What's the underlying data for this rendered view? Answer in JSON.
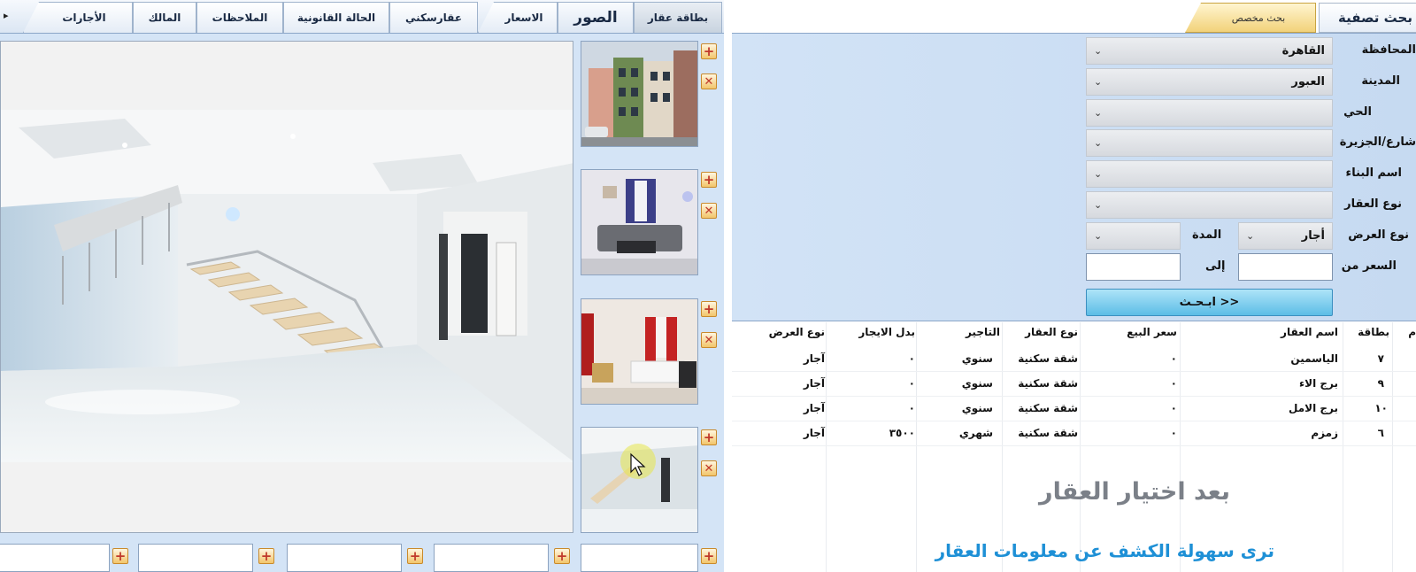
{
  "left_tabs": [
    {
      "id": "rentals",
      "label": "الأجارات"
    },
    {
      "id": "owner",
      "label": "المالك"
    },
    {
      "id": "notes",
      "label": "الملاحظات"
    },
    {
      "id": "legal",
      "label": "الحالة القانونية"
    },
    {
      "id": "aqarskni",
      "label": "عقارسكني"
    },
    {
      "id": "prices",
      "label": "الاسعار"
    },
    {
      "id": "photos",
      "label": "الصور"
    },
    {
      "id": "card",
      "label": "بطاقة عقار"
    }
  ],
  "right_tabs": {
    "special": "بحث مخصص",
    "filter": "بحث تصفية"
  },
  "filter": {
    "governorate_label": "المحافظة",
    "governorate_value": "القاهرة",
    "city_label": "المدينة",
    "city_value": "العبور",
    "district_label": "الحي",
    "district_value": "",
    "street_label": "شارع/الجزيرة",
    "street_value": "",
    "building_label": "اسم البناء",
    "building_value": "",
    "property_type_label": "نوع العقار",
    "property_type_value": "",
    "offer_type_label": "نوع العرض",
    "offer_type_value": "أجار",
    "duration_label": "المدة",
    "duration_value": "",
    "price_from_label": "السعر من",
    "price_to_label": "إلى",
    "search_label": "ابـحـث >>"
  },
  "table": {
    "headers": {
      "m": "م",
      "card": "بطاقة",
      "name": "اسم العقار",
      "sale": "سعر البيع",
      "type": "نوع العقار",
      "rent_term": "التاجير",
      "rent": "بدل الايجار",
      "offer": "نوع العرض"
    },
    "rows": [
      {
        "card": "٧",
        "name": "الياسمين",
        "sale": "٠",
        "type": "شقة سكنية",
        "rent_term": "سنوي",
        "rent": "٠",
        "offer": "آجار"
      },
      {
        "card": "٩",
        "name": "برج الاء",
        "sale": "٠",
        "type": "شقة سكنية",
        "rent_term": "سنوي",
        "rent": "٠",
        "offer": "آجار"
      },
      {
        "card": "١٠",
        "name": "برج الامل",
        "sale": "٠",
        "type": "شقة سكنية",
        "rent_term": "سنوي",
        "rent": "٠",
        "offer": "آجار"
      },
      {
        "card": "٦",
        "name": "زمزم",
        "sale": "٠",
        "type": "شقة سكنية",
        "rent_term": "شهري",
        "rent": "٣٥٠٠",
        "offer": "آجار"
      }
    ]
  },
  "promo": {
    "line1": "بعد اختيار العقار",
    "line2": "ترى سهولة الكشف عن معلومات العقار"
  },
  "icons": {
    "add": "+",
    "delete": "✕",
    "arrow": "▸",
    "chevron": "⌄"
  },
  "colors": {
    "accent": "#1e90d6",
    "panel": "#cfe0f4",
    "button": "#f2c56b"
  }
}
